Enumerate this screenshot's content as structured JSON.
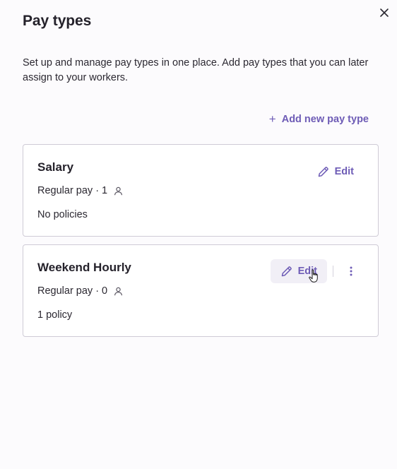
{
  "dialog": {
    "title": "Pay types",
    "description": "Set up and manage pay types in one place. Add pay types that you can later assign to your workers.",
    "add_label": "Add new pay type",
    "add_symbol": "+"
  },
  "pay_types": [
    {
      "name": "Salary",
      "type": "Regular pay",
      "separator": "·",
      "workers": "1",
      "policies": "No policies",
      "edit_label": "Edit"
    },
    {
      "name": "Weekend Hourly",
      "type": "Regular pay",
      "separator": "·",
      "workers": "0",
      "policies": "1 policy",
      "edit_label": "Edit"
    }
  ],
  "colors": {
    "accent": "#6e5cb6",
    "background": "#fcfbfd",
    "card_border": "#cfcbd6",
    "hover": "#f1eff6"
  },
  "icons": [
    "close-icon",
    "plus-icon",
    "pencil-icon",
    "person-icon",
    "more-vertical-icon",
    "hand-pointer-cursor"
  ]
}
